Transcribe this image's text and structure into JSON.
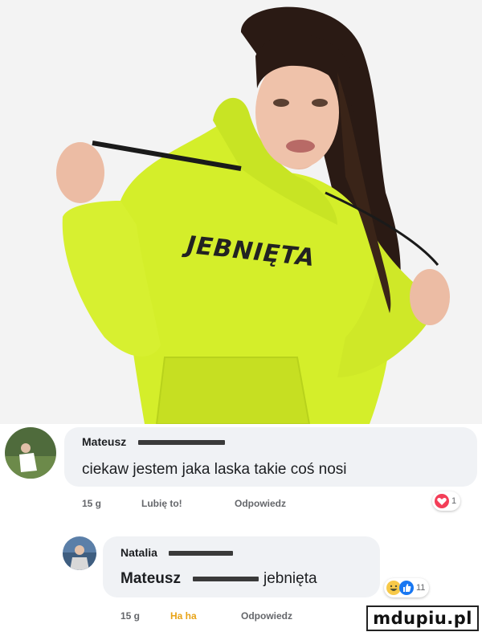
{
  "photo": {
    "hoodie_print": "JEBNIĘTA",
    "hoodie_color": "#d4ee2a",
    "background_color": "#f2f2f2"
  },
  "comments": [
    {
      "author": "Mateusz",
      "text": "ciekaw jestem jaka laska takie coś nosi",
      "time": "15 g",
      "actions": [
        "Lubię to!",
        "Odpowiedz"
      ],
      "reactions": {
        "icon": "love-reaction-icon",
        "count": "1"
      }
    },
    {
      "author": "Natalia",
      "mention": "Mateusz",
      "text": "jebnięta",
      "time": "15 g",
      "actions": [
        "Ha ha",
        "Odpowiedz"
      ],
      "reactions": {
        "icons": [
          "haha-reaction-icon",
          "like-reaction-icon"
        ],
        "count": "11"
      }
    }
  ],
  "watermark": "mdupiu.pl",
  "colors": {
    "bubble": "#f0f2f5",
    "meta_text": "#65676b",
    "haha_accent": "#e8a317",
    "like_blue": "#1877f2",
    "love_red": "#f33e58"
  }
}
